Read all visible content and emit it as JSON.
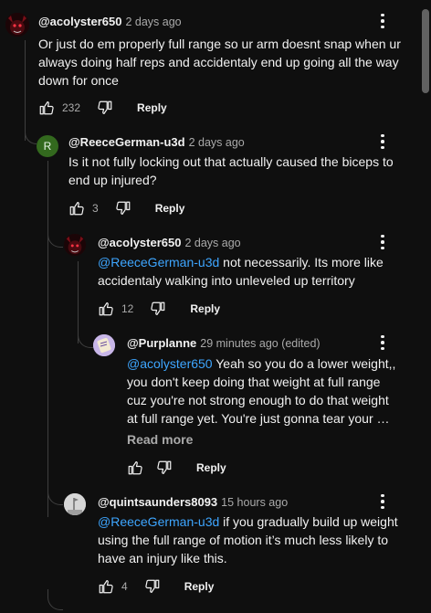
{
  "comments": [
    {
      "handle": "@acolyster650",
      "time": "2 days ago",
      "text": "Or just do em properly full range so ur arm doesnt snap when ur always doing half reps and accidentaly end up going all the way down for once",
      "likes": "232",
      "reply_label": "Reply",
      "avatar_icon": "demon-avatar-icon"
    },
    {
      "handle": "@ReeceGerman-u3d",
      "time": "2 days ago",
      "text": "Is it not fully locking out that actually caused the biceps to end up injured?",
      "likes": "3",
      "reply_label": "Reply",
      "avatar_letter": "R",
      "avatar_color": "#33691e"
    },
    {
      "handle": "@acolyster650",
      "time": "2 days ago",
      "mention": "@ReeceGerman-u3d",
      "text": " not necessarily. Its more like accidentaly walking into unleveled up territory",
      "likes": "12",
      "reply_label": "Reply",
      "avatar_icon": "demon-avatar-icon"
    },
    {
      "handle": "@Purplanne",
      "time": "29 minutes ago (edited)",
      "mention": "@acolyster650",
      "text": "  Yeah so you do a lower weight,, you don't keep doing that weight at full range cuz you're not strong enough to do that weight at full range yet. You're just gonna tear your …",
      "read_more": "Read more",
      "likes": "",
      "reply_label": "Reply",
      "avatar_icon": "scroll-avatar-icon"
    },
    {
      "handle": "@quintsaunders8093",
      "time": "15 hours ago",
      "mention": "@ReeceGerman-u3d",
      "text": " if you gradually build up weight using the full range of motion it’s much less likely to have an injury like this.",
      "likes": "4",
      "reply_label": "Reply",
      "avatar_icon": "flag-avatar-icon"
    }
  ],
  "colors": {
    "background": "#0f0f0f",
    "text": "#f1f1f1",
    "secondary": "#aaaaaa",
    "link": "#3ea6ff"
  }
}
